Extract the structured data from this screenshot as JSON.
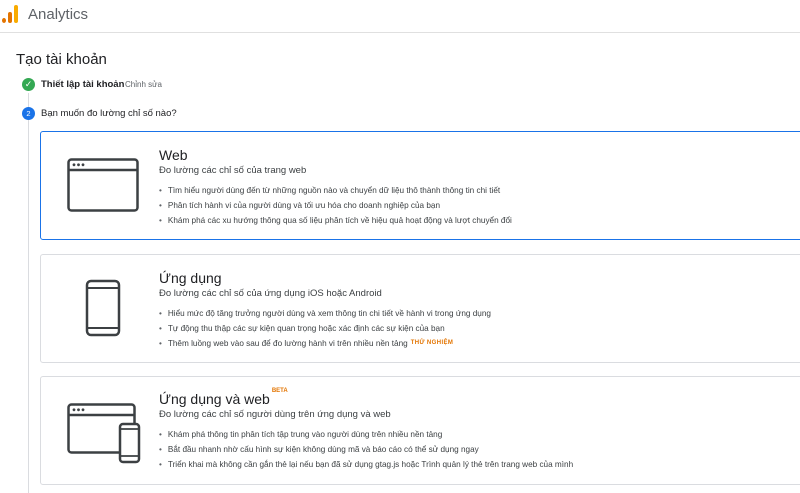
{
  "app": {
    "title": "Analytics"
  },
  "page": {
    "title": "Tạo tài khoản"
  },
  "steps": [
    {
      "icon": "check-circle-icon",
      "label": "Thiết lập tài khoản",
      "edit_label": "Chỉnh sửa"
    },
    {
      "number": "2",
      "label": "Bạn muốn đo lường chỉ số nào?"
    }
  ],
  "options": [
    {
      "icon": "web-browser-icon",
      "title": "Web",
      "subtitle": "Đo lường các chỉ số của trang web",
      "bullets": [
        "Tìm hiểu người dùng đến từ những nguồn nào và chuyển dữ liệu thô thành thông tin chi tiết",
        "Phân tích hành vi của người dùng và tối ưu hóa cho doanh nghiệp của bạn",
        "Khám phá các xu hướng thông qua số liệu phân tích về hiệu quả hoạt động và lượt chuyển đổi"
      ]
    },
    {
      "icon": "mobile-phone-icon",
      "title": "Ứng dụng",
      "subtitle": "Đo lường các chỉ số của ứng dụng iOS hoặc Android",
      "bullets": [
        "Hiểu mức độ tăng trưởng người dùng và xem thông tin chi tiết về hành vi trong ứng dụng",
        "Tự động thu thập các sự kiện quan trọng hoặc xác định các sự kiện của bạn",
        "Thêm luồng web vào sau để đo lường hành vi trên nhiều nền tảng"
      ],
      "badge": "THỬ NGHIỆM"
    },
    {
      "icon": "app-and-web-icon",
      "title": "Ứng dụng và web",
      "title_badge": "BETA",
      "subtitle": "Đo lường các chỉ số người dùng trên ứng dụng và web",
      "bullets": [
        "Khám phá thông tin phân tích tập trung vào người dùng trên nhiều nền tảng",
        "Bắt đầu nhanh nhờ cấu hình sự kiện không dùng mã và báo cáo có thể sử dụng ngay",
        "Triển khai mà không cần gắn thẻ lại nếu bạn đã sử dụng gtag.js hoặc Trình quản lý thẻ trên trang web của mình"
      ]
    }
  ],
  "colors": {
    "accent": "#1a73e8",
    "success": "#34a853",
    "brand_orange": "#e37400",
    "brand_yellow": "#f9ab00"
  }
}
